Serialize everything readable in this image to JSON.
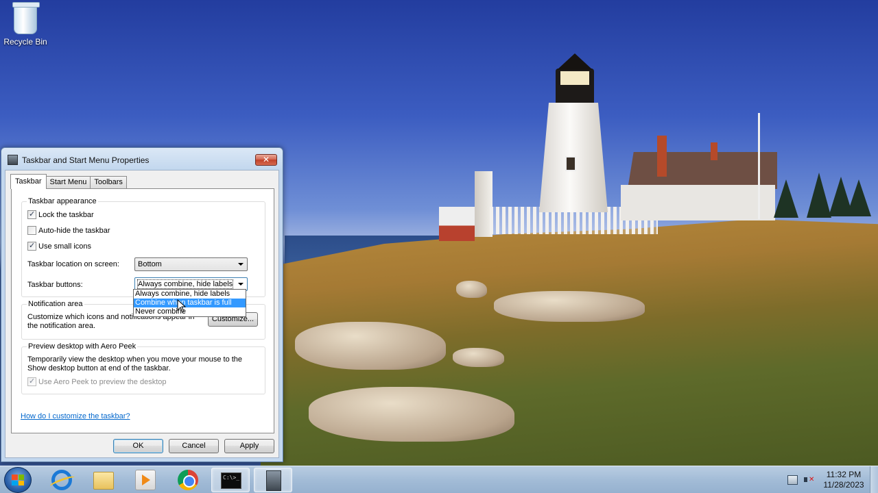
{
  "desktop": {
    "icons": [
      {
        "label": "Recycle Bin",
        "icon": "recycle-bin-icon"
      }
    ]
  },
  "dialog": {
    "title": "Taskbar and Start Menu Properties",
    "close_label": "✕",
    "tabs": [
      {
        "label": "Taskbar",
        "active": true
      },
      {
        "label": "Start Menu",
        "active": false
      },
      {
        "label": "Toolbars",
        "active": false
      }
    ],
    "appearance": {
      "title": "Taskbar appearance",
      "lock_taskbar": {
        "label": "Lock the taskbar",
        "checked": true
      },
      "auto_hide": {
        "label": "Auto-hide the taskbar",
        "checked": false
      },
      "small_icons": {
        "label": "Use small icons",
        "checked": true
      },
      "location_label": "Taskbar location on screen:",
      "location_value": "Bottom",
      "buttons_label": "Taskbar buttons:",
      "buttons_value": "Always combine, hide labels"
    },
    "buttons_options": [
      {
        "label": "Always combine, hide labels",
        "selected": false
      },
      {
        "label": "Combine when taskbar is full",
        "selected": true
      },
      {
        "label": "Never combine",
        "selected": false
      }
    ],
    "notification": {
      "title": "Notification area",
      "description": "Customize which icons and notifications appear in the notification area.",
      "customize_label": "Customize..."
    },
    "peek": {
      "title": "Preview desktop with Aero Peek",
      "description": "Temporarily view the desktop when you move your mouse to the Show desktop button at end of the taskbar.",
      "checkbox": {
        "label": "Use Aero Peek to preview the desktop",
        "checked": true,
        "enabled": false
      }
    },
    "help_link": "How do I customize the taskbar?",
    "ok_label": "OK",
    "cancel_label": "Cancel",
    "apply_label": "Apply"
  },
  "taskbar": {
    "start_icon": "windows-start-icon",
    "pinned": [
      {
        "name": "internet-explorer-icon",
        "active": false
      },
      {
        "name": "file-explorer-icon",
        "active": false
      },
      {
        "name": "media-player-icon",
        "active": false
      },
      {
        "name": "chrome-icon",
        "active": false
      },
      {
        "name": "command-prompt-icon",
        "active": true
      },
      {
        "name": "taskbar-properties-icon",
        "active": true
      }
    ],
    "cmd_text": "C:\\>_",
    "tray": {
      "time": "11:32 PM",
      "date": "11/28/2023"
    }
  },
  "colors": {
    "selection": "#3399ff",
    "link": "#0066cc",
    "close_button": "#c04129"
  }
}
